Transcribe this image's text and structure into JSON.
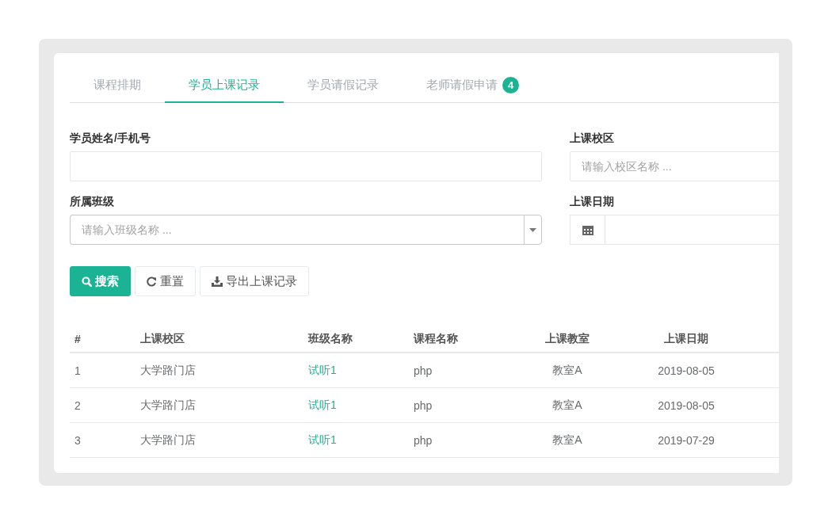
{
  "tabs": [
    {
      "label": "课程排期",
      "selected": false
    },
    {
      "label": "学员上课记录",
      "selected": true
    },
    {
      "label": "学员请假记录",
      "selected": false
    },
    {
      "label": "老师请假申请",
      "selected": false,
      "badge": "4"
    }
  ],
  "filters": [
    {
      "kind": "text",
      "label": "学员姓名/手机号"
    },
    {
      "kind": "text",
      "label": "上课校区",
      "placeholder": "请输入校区名称 ..."
    },
    {
      "kind": "select",
      "label": "所属班级",
      "placeholder": "请输入班级名称 ..."
    },
    {
      "kind": "date",
      "label": "上课日期"
    }
  ],
  "buttons": [
    {
      "kind": "search",
      "label": "搜索"
    },
    {
      "kind": "reset",
      "label": "重置"
    },
    {
      "kind": "export",
      "label": "导出上课记录"
    }
  ],
  "table": {
    "columns": [
      "#",
      "上课校区",
      "班级名称",
      "课程名称",
      "上课教室",
      "上课日期"
    ],
    "rows": [
      {
        "index": "1",
        "campus": "大学路门店",
        "class_name": "试听1",
        "course": "php",
        "classroom": "教室A",
        "date": "2019-08-05"
      },
      {
        "index": "2",
        "campus": "大学路门店",
        "class_name": "试听1",
        "course": "php",
        "classroom": "教室A",
        "date": "2019-08-05"
      },
      {
        "index": "3",
        "campus": "大学路门店",
        "class_name": "试听1",
        "course": "php",
        "classroom": "教室A",
        "date": "2019-07-29"
      }
    ]
  }
}
